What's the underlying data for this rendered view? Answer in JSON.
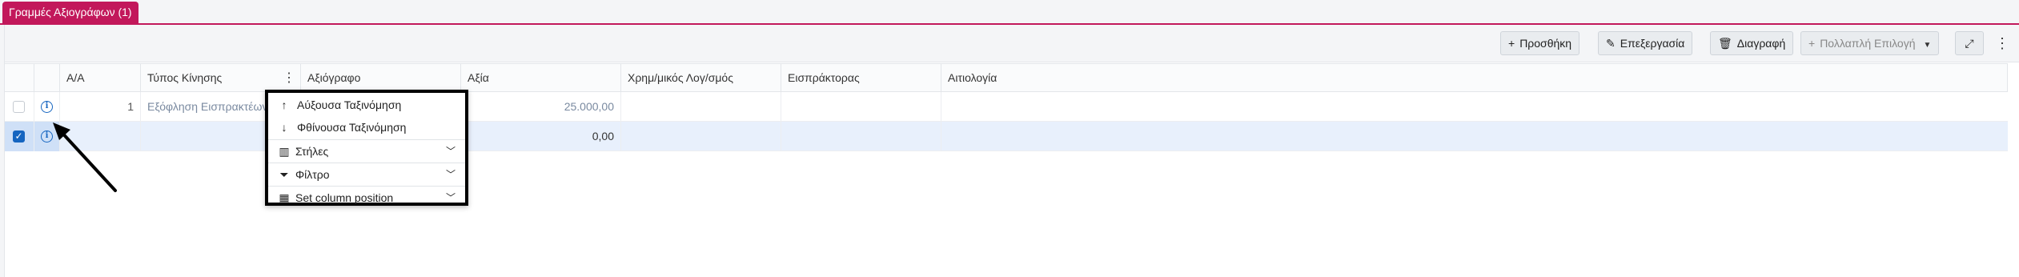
{
  "tab": {
    "label": "Γραμμές Αξιογράφων (1)"
  },
  "toolbar": {
    "add": "Προσθήκη",
    "edit": "Επεξεργασία",
    "delete": "Διαγραφή",
    "multi": "Πολλαπλή Επιλογή"
  },
  "grid": {
    "headers": [
      "Α/Α",
      "Τύπος Κίνησης",
      "Αξιόγραφο",
      "Αξία",
      "Χρημ/μικός Λογ/σμός",
      "Εισπράκτορας",
      "Αιτιολογία"
    ],
    "rows": [
      {
        "aa": "1",
        "type": "Εξόφληση Εισπρακτέων",
        "value": "25.000,00",
        "selected": false
      },
      {
        "aa": "",
        "type": "",
        "value": "0,00",
        "selected": true
      }
    ]
  },
  "menu": {
    "asc": "Αύξουσα Ταξινόμηση",
    "desc": "Φθίνουσα Ταξινόμηση",
    "columns": "Στήλες",
    "filter": "Φίλτρο",
    "position": "Set column position"
  },
  "colors": {
    "accent": "#c2185b",
    "primary": "#1565c0"
  }
}
